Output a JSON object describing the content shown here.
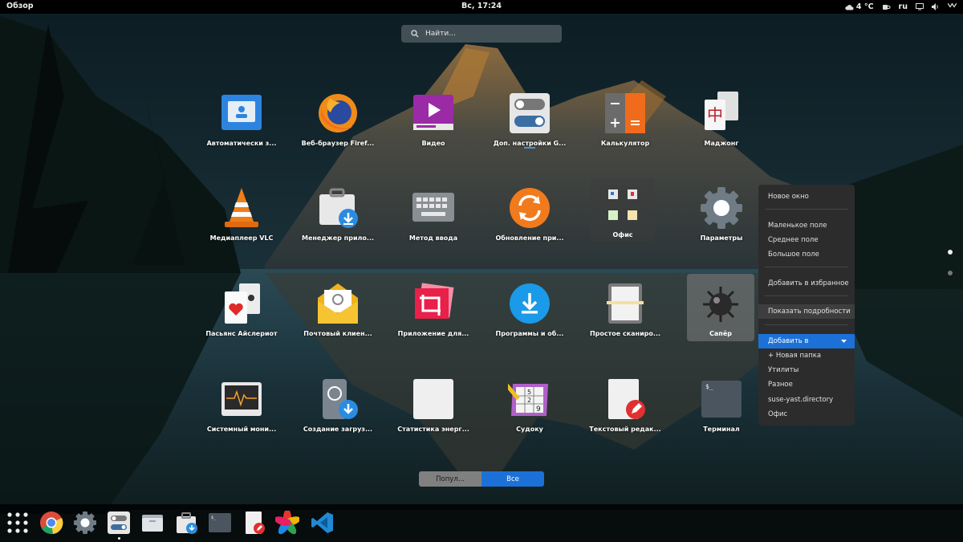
{
  "topbar": {
    "activities": "Обзор",
    "clock": "Вс, 17:24",
    "weather": "4 °C",
    "language": "ru"
  },
  "search": {
    "placeholder": "Найти..."
  },
  "apps": [
    {
      "label": "Автоматически з...",
      "icon": "contact-card-icon"
    },
    {
      "label": "Веб-браузер Firef...",
      "icon": "firefox-icon"
    },
    {
      "label": "Видео",
      "icon": "video-player-icon"
    },
    {
      "label": "Доп. настройки G...",
      "icon": "tweaks-icon"
    },
    {
      "label": "Калькулятор",
      "icon": "calculator-icon"
    },
    {
      "label": "Маджонг",
      "icon": "mahjong-icon"
    },
    {
      "label": "Медиаплеер VLC",
      "icon": "vlc-icon"
    },
    {
      "label": "Менеджер прило...",
      "icon": "app-manager-icon"
    },
    {
      "label": "Метод ввода",
      "icon": "keyboard-icon"
    },
    {
      "label": "Обновление при...",
      "icon": "update-icon"
    },
    {
      "label": "Офис",
      "icon": "office-folder-icon"
    },
    {
      "label": "Параметры",
      "icon": "settings-gear-icon"
    },
    {
      "label": "Пасьянс Айслериот",
      "icon": "solitaire-icon"
    },
    {
      "label": "Почтовый клиен...",
      "icon": "mail-icon"
    },
    {
      "label": "Приложение для...",
      "icon": "crop-photo-icon"
    },
    {
      "label": "Программы и об...",
      "icon": "software-download-icon"
    },
    {
      "label": "Простое сканиро...",
      "icon": "scanner-icon"
    },
    {
      "label": "Сапёр",
      "icon": "mine-icon"
    },
    {
      "label": "Системный мони...",
      "icon": "system-monitor-icon"
    },
    {
      "label": "Создание загруз...",
      "icon": "usb-creator-icon"
    },
    {
      "label": "Статистика энерг...",
      "icon": "power-statistics-icon"
    },
    {
      "label": "Судоку",
      "icon": "sudoku-icon"
    },
    {
      "label": "Текстовый редак...",
      "icon": "text-editor-icon"
    },
    {
      "label": "Терминал",
      "icon": "terminal-icon"
    }
  ],
  "context_menu": {
    "new_window": "Новое окно",
    "small_field": "Маленькое поле",
    "medium_field": "Среднее поле",
    "large_field": "Большое поле",
    "add_favorites": "Добавить в избранное",
    "show_details": "Показать подробности",
    "add_to": "Добавить в",
    "new_folder": "+ Новая папка",
    "utilities": "Утилиты",
    "misc": "Разное",
    "suse_dir": "suse-yast.directory",
    "office": "Офис"
  },
  "view_switcher": {
    "popular": "Попул...",
    "all": "Все",
    "active": "all"
  },
  "dock": [
    "app-grid-icon",
    "chrome-icon",
    "settings-icon",
    "tweaks-icon",
    "files-icon",
    "app-manager-icon",
    "terminal-icon",
    "text-editor-icon",
    "photos-icon",
    "vscode-icon"
  ],
  "colors": {
    "accent": "#1c71d8",
    "menu_bg": "#2c2c2c"
  }
}
